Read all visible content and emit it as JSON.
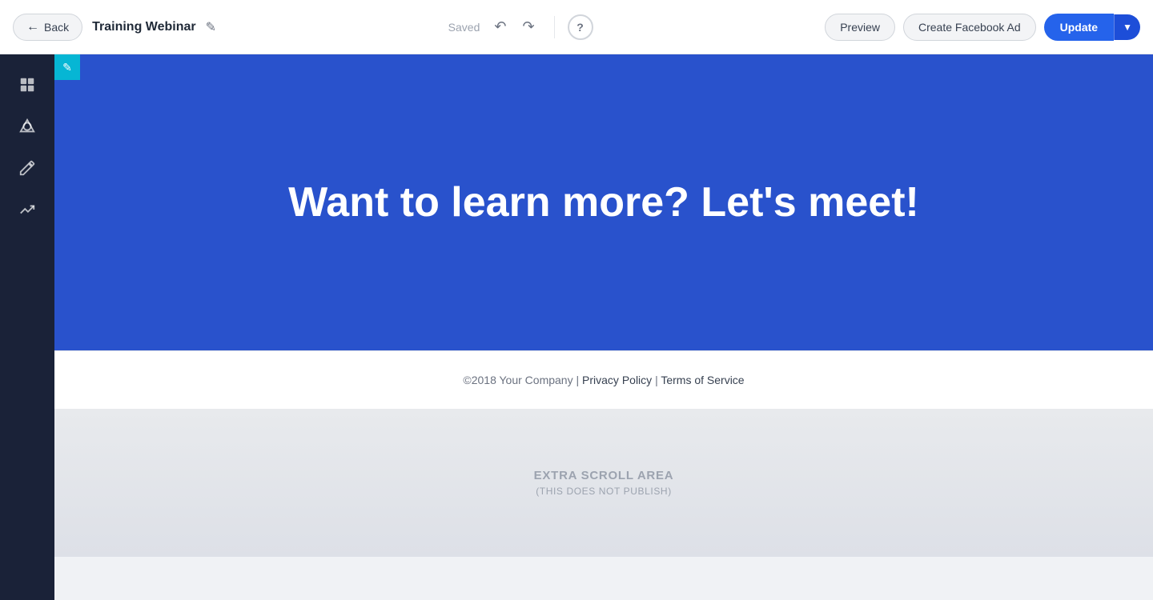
{
  "header": {
    "back_label": "Back",
    "page_title": "Training Webinar",
    "saved_text": "Saved",
    "help_label": "?",
    "preview_label": "Preview",
    "create_facebook_ad_label": "Create Facebook Ad",
    "update_label": "Update"
  },
  "sidebar": {
    "items": [
      {
        "name": "layers-icon",
        "symbol": "⊞"
      },
      {
        "name": "shapes-icon",
        "symbol": "◈"
      },
      {
        "name": "pen-icon",
        "symbol": "✏"
      },
      {
        "name": "analytics-icon",
        "symbol": "↗"
      }
    ]
  },
  "hero": {
    "text": "Want to learn more? Let's meet!"
  },
  "footer": {
    "copyright": "©2018 Your Company",
    "separator1": "|",
    "privacy_policy": "Privacy Policy",
    "separator2": "|",
    "terms": "Terms of Service"
  },
  "extra_scroll": {
    "title": "EXTRA SCROLL AREA",
    "subtitle": "(THIS DOES NOT PUBLISH)"
  },
  "colors": {
    "hero_bg": "#2952cc",
    "sidebar_bg": "#1a2238",
    "update_btn": "#2563eb",
    "edit_indicator": "#06b6d4"
  }
}
